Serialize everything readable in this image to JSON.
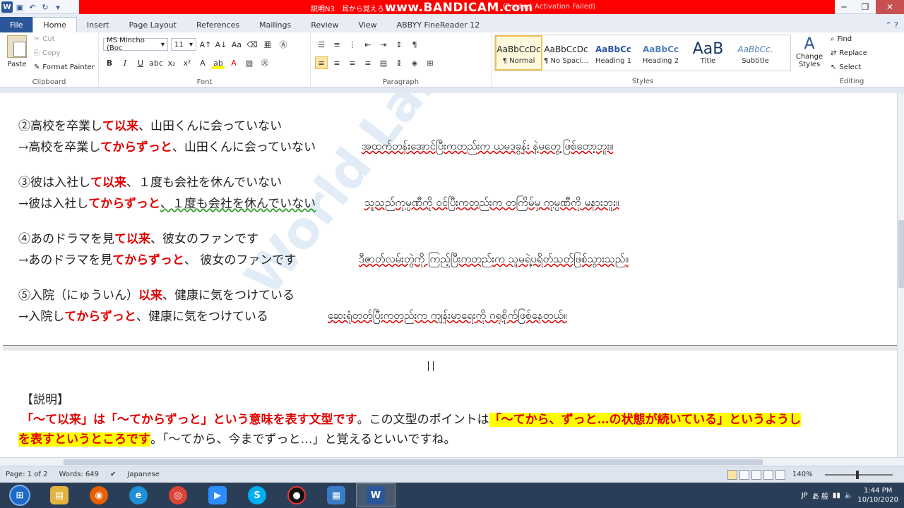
{
  "window": {
    "title": "説明N3　耳から覚えろ　...",
    "overlay_title": "www.BANDICAM.com",
    "activation": "(Product Activation Failed)"
  },
  "tabs": [
    "File",
    "Home",
    "Insert",
    "Page Layout",
    "References",
    "Mailings",
    "Review",
    "View",
    "ABBYY FineReader 12"
  ],
  "active_tab": "Home",
  "ribbon": {
    "clipboard": {
      "paste": "Paste",
      "cut": "Cut",
      "copy": "Copy",
      "format_painter": "Format Painter",
      "label": "Clipboard"
    },
    "font": {
      "family": "MS Mincho (Boc",
      "size": "11",
      "label": "Font"
    },
    "paragraph": {
      "label": "Paragraph"
    },
    "styles": {
      "label": "Styles",
      "items": [
        {
          "preview": "AaBbCcDc",
          "name": "¶ Normal"
        },
        {
          "preview": "AaBbCcDc",
          "name": "¶ No Spaci..."
        },
        {
          "preview": "AaBbCc",
          "name": "Heading 1"
        },
        {
          "preview": "AaBbCc",
          "name": "Heading 2"
        },
        {
          "preview": "AaB",
          "name": "Title"
        },
        {
          "preview": "AaBbCc.",
          "name": "Subtitle"
        }
      ],
      "change_styles": "Change Styles"
    },
    "editing": {
      "find": "Find",
      "replace": "Replace",
      "select": "Select",
      "label": "Editing"
    }
  },
  "document": {
    "item2": {
      "line1_a": "②高校を卒業し",
      "line1_red": "て以来",
      "line1_b": "、山田くんに会っていない",
      "line2_a": "→高校を卒業し",
      "line2_red": "てからずっと",
      "line2_b": "、山田くんに会っていない",
      "burmese": "အထက်တန်းအောင်ပြီးကတည်းက ယမဒခွန်း နဲ့မတွေ့ဖြစ်တော့ဘူး။"
    },
    "item3": {
      "line1_a": "③彼は入社し",
      "line1_red": "て以来",
      "line1_b": "、１度も会社を休んでいない",
      "line2_a": "→彼は入社し",
      "line2_red": "てからずっと",
      "line2_b": "、１度も会社を休んでいない",
      "burmese": "သူသည်ကုမ္ပဏီကို ဝင်ပြီးကတည်းက တကြိမ်မှ ကုမ္ပဏီကို မနားဘူး။"
    },
    "item4": {
      "line1_a": "④あのドラマを見",
      "line1_red": "て以来",
      "line1_b": "、彼女のファンです",
      "line2_a": "→あのドラマを見",
      "line2_red": "てからずっと",
      "line2_b": "、 彼女のファンです",
      "burmese": "ဒီဇာတ်လမ်းတွဲကို ကြည့်ပြီးကတည်းက သူမရဲ့ပရိတ်သတ်ဖြစ်သွားသည်။"
    },
    "item5": {
      "line1_a": "⑤入院（にゅういん）",
      "line1_red": "以来",
      "line1_b": "、健康に気をつけている",
      "line2_a": "→入院し",
      "line2_red": "てからずっと",
      "line2_b": "、健康に気をつけている",
      "burmese": "ဆေးရုံတတ်ပြီးကတည်းက ကျန်းမာရေးကို ဂရုစိုက်ဖြစ်နေတယ်။"
    },
    "explanation": {
      "heading": "【説明】",
      "p1_red": "「～て以来」は「～てからずっと」という意味を表す文型です",
      "p1_mid": "。この文型のポイントは",
      "p1_hl": "「～てから、ずっと…の状態が続いている」というようし",
      "p2_hl": "を表すというところです",
      "p2_rest": "。「～てから、今までずっと…」と覚えるといいですね。"
    },
    "watermark": "World Language Centre"
  },
  "status": {
    "page": "Page: 1 of 2",
    "words": "Words: 649",
    "language": "Japanese",
    "zoom": "140%"
  },
  "taskbar": {
    "time": "1:44 PM",
    "date": "10/10/2020",
    "lang": "JP",
    "ime": "あ 般"
  },
  "colors": {
    "accent": "#2b579a",
    "red_text": "#e00000",
    "highlight": "#ffff00",
    "bandicam_bar": "#ff0000"
  }
}
